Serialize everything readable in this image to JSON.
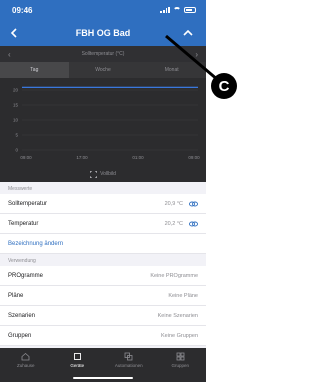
{
  "status_bar": {
    "time": "09:46"
  },
  "nav": {
    "title": "FBH OG Bad"
  },
  "chart": {
    "header_title": "Solltemperatur (°C)",
    "tabs": [
      {
        "label": "Tag",
        "active": true
      },
      {
        "label": "Woche",
        "active": false
      },
      {
        "label": "Monat",
        "active": false
      }
    ],
    "fullscreen_label": "Vollbild",
    "line_color": "#3b82f6"
  },
  "chart_data": {
    "type": "line",
    "x_ticks": [
      "09:00",
      "17:00",
      "01:00",
      "09:00"
    ],
    "y_ticks": [
      20,
      15,
      10,
      5,
      0
    ],
    "ylim": [
      0,
      22
    ],
    "series": [
      {
        "values": [
          20.9,
          20.9,
          20.9,
          20.9
        ]
      }
    ]
  },
  "measurements": {
    "section_label": "Messwerte",
    "rows": [
      {
        "label": "Solltemperatur",
        "value": "20,9 °C"
      },
      {
        "label": "Temperatur",
        "value": "20,2 °C"
      }
    ],
    "rename_link": "Bezeichnung ändern"
  },
  "usage": {
    "section_label": "Verwendung",
    "rows": [
      {
        "label": "PROgramme",
        "value": "Keine PROgramme"
      },
      {
        "label": "Pläne",
        "value": "Keine Pläne"
      },
      {
        "label": "Szenarien",
        "value": "Keine Szenarien"
      },
      {
        "label": "Gruppen",
        "value": "Keine Gruppen"
      }
    ]
  },
  "tab_bar": {
    "items": [
      {
        "label": "Zuhause",
        "icon": "home-icon",
        "active": false
      },
      {
        "label": "Geräte",
        "icon": "devices-icon",
        "active": true
      },
      {
        "label": "Automationen",
        "icon": "automations-icon",
        "active": false
      },
      {
        "label": "Gruppen",
        "icon": "groups-icon",
        "active": false
      }
    ]
  },
  "annotation": {
    "badge": "C"
  }
}
